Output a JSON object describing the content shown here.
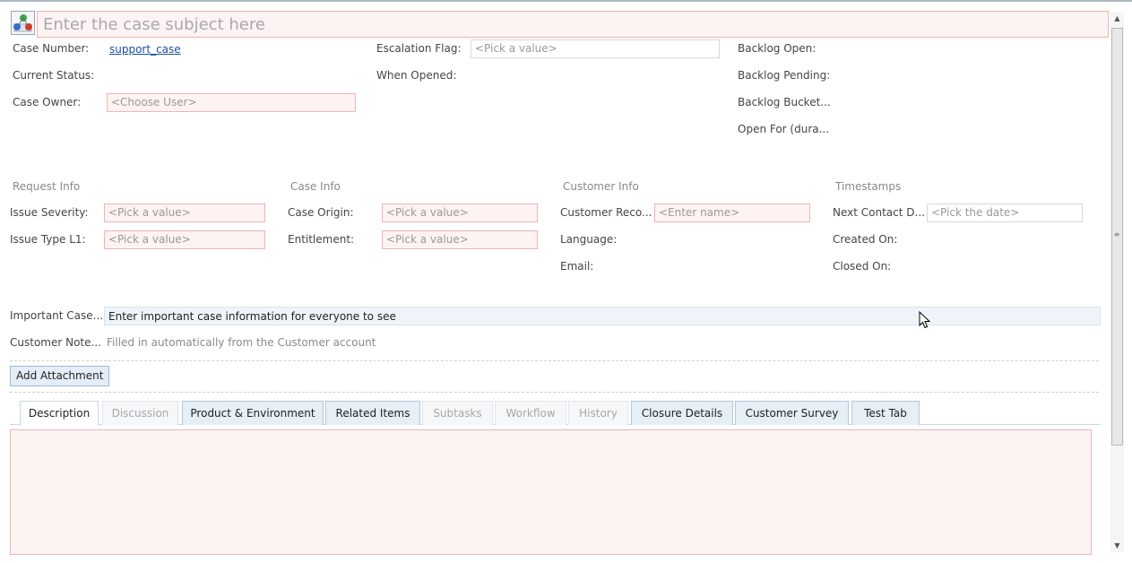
{
  "subject": {
    "placeholder": "Enter the case subject here"
  },
  "header": {
    "case_number_label": "Case Number:",
    "case_number_value": "support_case",
    "current_status_label": "Current Status:",
    "case_owner_label": "Case Owner:",
    "case_owner_placeholder": "<Choose User>",
    "escalation_flag_label": "Escalation Flag:",
    "escalation_flag_placeholder": "<Pick a value>",
    "when_opened_label": "When Opened:",
    "backlog_open_label": "Backlog Open:",
    "backlog_pending_label": "Backlog Pending:",
    "backlog_bucket_label": "Backlog Bucket...",
    "open_for_label": "Open For (dura..."
  },
  "sections": {
    "request_info": {
      "title": "Request Info",
      "issue_severity_label": "Issue Severity:",
      "issue_severity_placeholder": "<Pick a value>",
      "issue_type_label": "Issue Type L1:",
      "issue_type_placeholder": "<Pick a value>"
    },
    "case_info": {
      "title": "Case Info",
      "case_origin_label": "Case Origin:",
      "case_origin_placeholder": "<Pick a value>",
      "entitlement_label": "Entitlement:",
      "entitlement_placeholder": "<Pick a value>"
    },
    "customer_info": {
      "title": "Customer Info",
      "customer_record_label": "Customer Reco...",
      "customer_record_placeholder": "<Enter name>",
      "language_label": "Language:",
      "email_label": "Email:"
    },
    "timestamps": {
      "title": "Timestamps",
      "next_contact_label": "Next Contact D...",
      "next_contact_placeholder": "<Pick the date>",
      "created_on_label": "Created On:",
      "closed_on_label": "Closed On:"
    }
  },
  "notes": {
    "important_label": "Important Case...",
    "important_value": "Enter important case information for everyone to see",
    "customer_notes_label": "Customer Note...",
    "customer_notes_value": "Filled in automatically from the Customer account"
  },
  "attachment": {
    "button_label": "Add Attachment"
  },
  "tabs": [
    {
      "label": "Description",
      "state": "active"
    },
    {
      "label": "Discussion",
      "state": "disabled"
    },
    {
      "label": "Product & Environment",
      "state": "enabled"
    },
    {
      "label": "Related Items",
      "state": "enabled"
    },
    {
      "label": "Subtasks",
      "state": "disabled"
    },
    {
      "label": "Workflow",
      "state": "disabled"
    },
    {
      "label": "History",
      "state": "disabled"
    },
    {
      "label": "Closure Details",
      "state": "enabled"
    },
    {
      "label": "Customer Survey",
      "state": "enabled"
    },
    {
      "label": "Test Tab",
      "state": "enabled"
    }
  ],
  "icons": {
    "app": "app-icon",
    "scroll_up": "scroll-up-icon",
    "scroll_down": "scroll-down-icon",
    "cursor": "mouse-cursor-icon"
  },
  "colors": {
    "required_border": "#f0b4b4",
    "required_fill": "#fdf3f3",
    "link": "#1b4ea0",
    "tab_enabled": "#e6eef6"
  }
}
